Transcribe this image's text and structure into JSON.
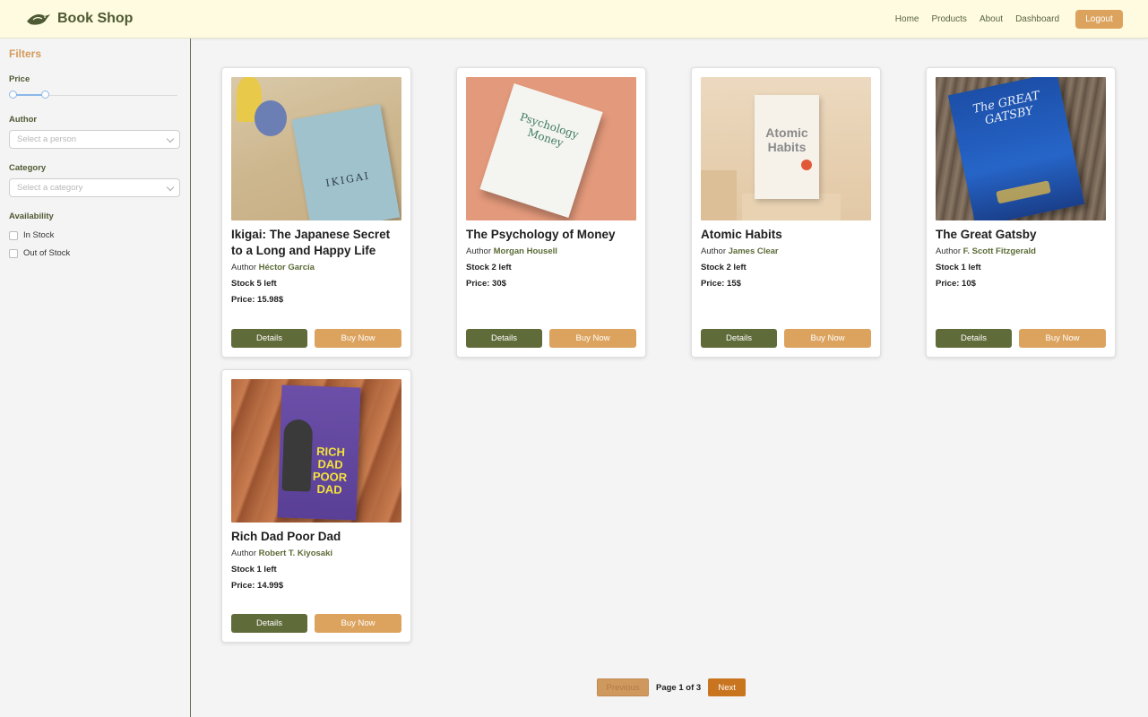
{
  "brand": {
    "name": "Book Shop",
    "logo_icon": "bird-icon"
  },
  "nav": {
    "links": [
      "Home",
      "Products",
      "About",
      "Dashboard"
    ],
    "logout_label": "Logout"
  },
  "filters": {
    "title": "Filters",
    "price_label": "Price",
    "author_label": "Author",
    "author_placeholder": "Select a person",
    "category_label": "Category",
    "category_placeholder": "Select a category",
    "availability_label": "Availability",
    "in_stock_label": "In Stock",
    "out_of_stock_label": "Out of Stock"
  },
  "books": [
    {
      "title": "Ikigai: The Japanese Secret to a Long and Happy Life",
      "author_prefix": "Author",
      "author": "Héctor García",
      "stock": "Stock 5 left",
      "price": "Price: 15.98$",
      "cover_text": "IKIGAI"
    },
    {
      "title": "The Psychology of Money",
      "author_prefix": "Author",
      "author": "Morgan Housell",
      "stock": "Stock 2 left",
      "price": "Price: 30$",
      "cover_text": "Psychology Money"
    },
    {
      "title": "Atomic Habits",
      "author_prefix": "Author",
      "author": "James Clear",
      "stock": "Stock 2 left",
      "price": "Price: 15$",
      "cover_text": "Atomic Habits"
    },
    {
      "title": "The Great Gatsby",
      "author_prefix": "Author",
      "author": "F. Scott Fitzgerald",
      "stock": "Stock 1 left",
      "price": "Price: 10$",
      "cover_text": "The GREAT GATSBY"
    },
    {
      "title": "Rich Dad Poor Dad",
      "author_prefix": "Author",
      "author": "Robert T. Kiyosaki",
      "stock": "Stock 1 left",
      "price": "Price: 14.99$",
      "cover_text": "RICH DAD POOR DAD"
    }
  ],
  "card_actions": {
    "details_label": "Details",
    "buy_label": "Buy Now"
  },
  "pagination": {
    "previous_label": "Previous",
    "page_info": "Page 1 of 3",
    "next_label": "Next"
  },
  "colors": {
    "olive": "#606b3a",
    "tan": "#dca35e",
    "header_bg": "#fefbe0",
    "orange": "#c9741e"
  }
}
